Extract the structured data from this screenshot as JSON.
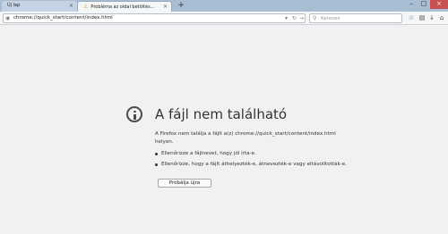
{
  "tabs": [
    {
      "label": "Új lap"
    },
    {
      "label": "Probléma az oldal betöltés..."
    }
  ],
  "toolbar": {
    "url": "chrome://quick_start/content/index.html",
    "search_placeholder": "Keresés"
  },
  "error": {
    "title": "A fájl nem található",
    "description": "A Firefox nem találja a fájlt a(z) chrome://quick_start/content/index.html helyen.",
    "suggestions": [
      "Ellenőrizze a fájlnevet, hogy jól írta-e.",
      "Ellenőrizze, hogy a fájlt áthelyezték-e, átnevezték-e vagy eltávolították-e."
    ],
    "retry_label": "Próbálja újra"
  },
  "colors": {
    "tabbar": "#a9bdd3",
    "active_tab": "#f5f6f7",
    "page_background": "#f1f1f1",
    "warning_icon": "#d8a400"
  },
  "icons": {
    "tab_warning": "warning-icon",
    "url_prefix": "globe-icon",
    "search": "search-icon",
    "error": "info-circle-icon"
  }
}
